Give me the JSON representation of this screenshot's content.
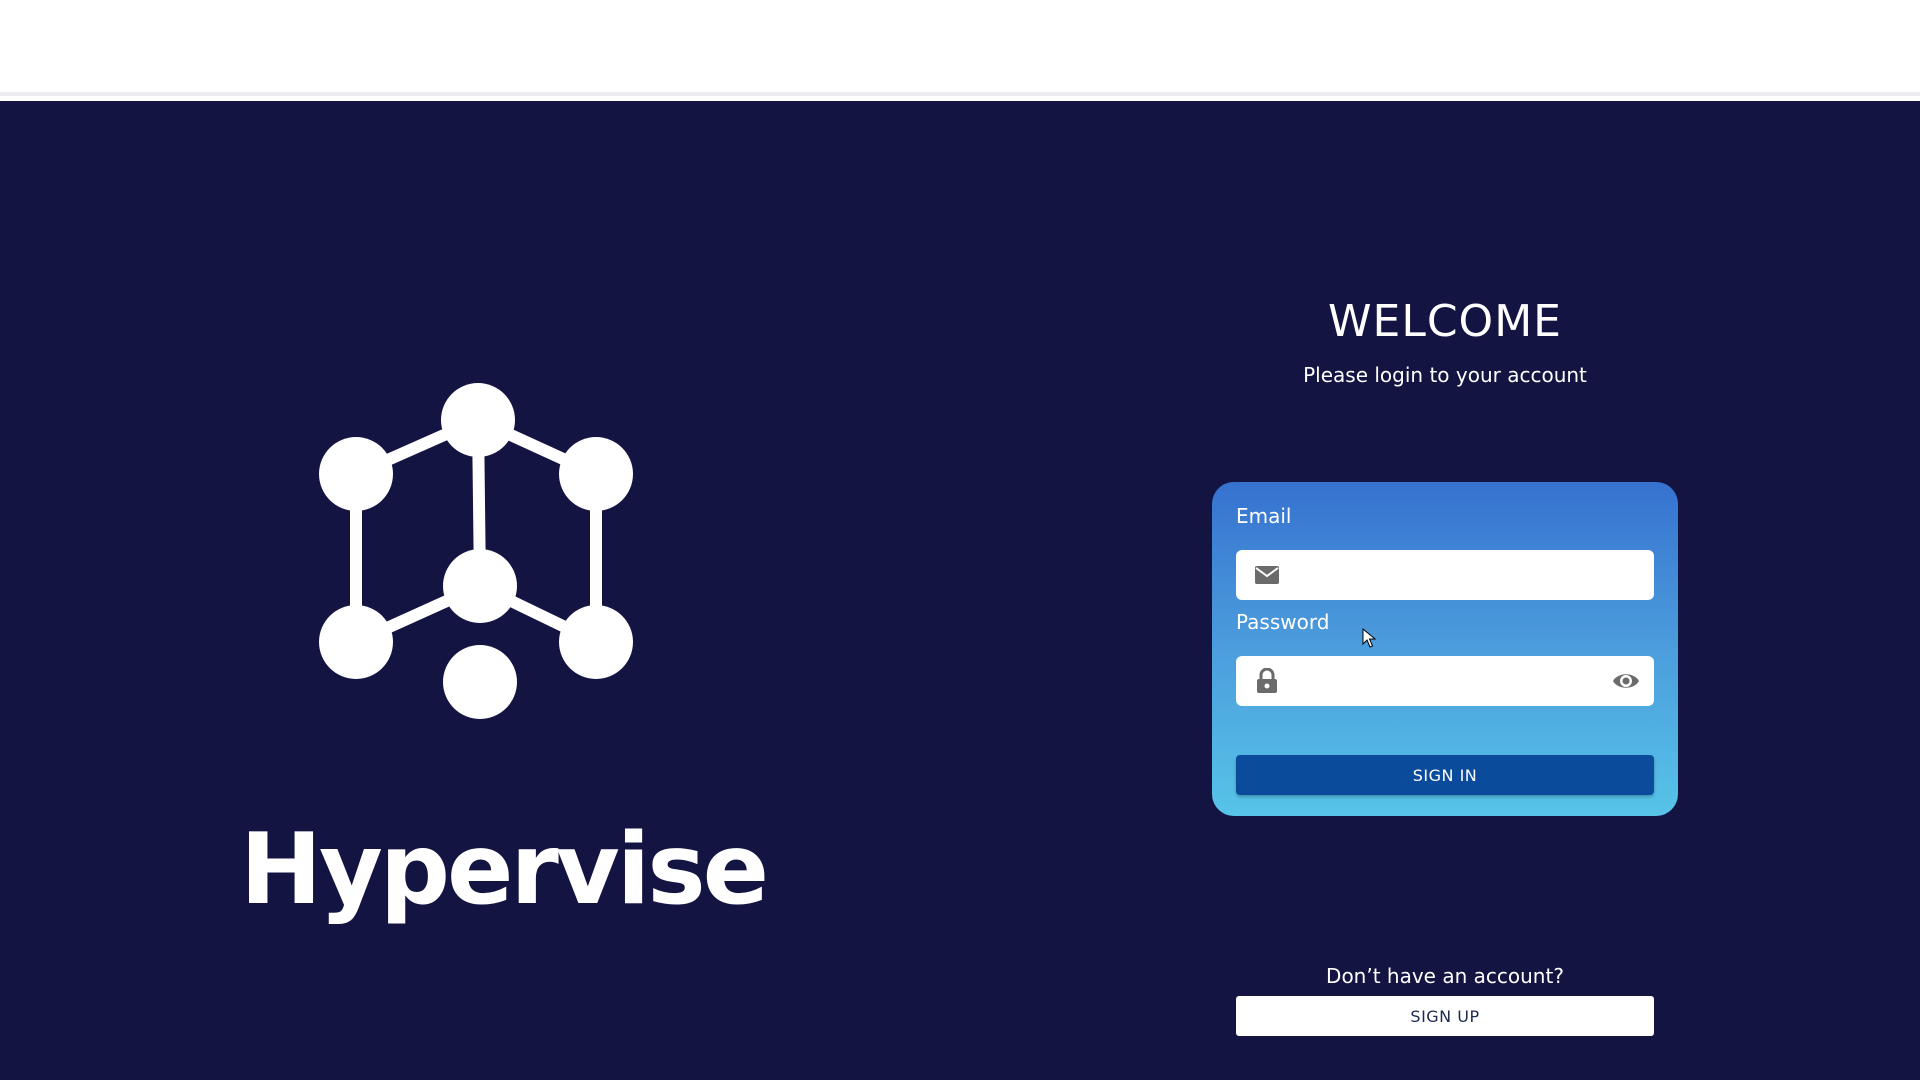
{
  "brand": {
    "name": "Hypervise"
  },
  "login": {
    "title": "WELCOME",
    "subtitle": "Please login to your account",
    "email_label": "Email",
    "email_value": "",
    "password_label": "Password",
    "password_value": "",
    "sign_in_label": "SIGN IN",
    "no_account_text": "Don’t have an account?",
    "sign_up_label": "SIGN UP"
  },
  "icons": {
    "email": "envelope-icon",
    "password": "lock-icon",
    "toggle_password": "eye-icon"
  },
  "colors": {
    "background": "#141443",
    "card_top": "#3672d0",
    "card_bottom": "#57c4e8",
    "sign_in_button": "#0a4b9c",
    "text": "#ffffff"
  }
}
